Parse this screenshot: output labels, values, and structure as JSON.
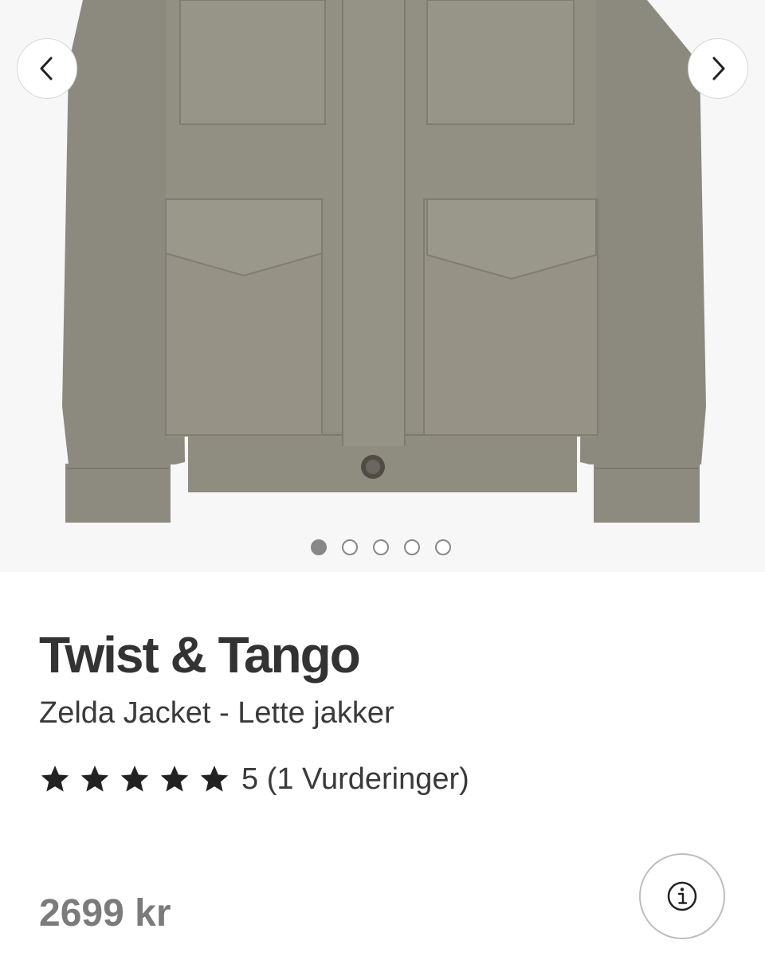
{
  "gallery": {
    "image_alt": "Zelda Jacket",
    "prev_icon": "chevron-left-icon",
    "next_icon": "chevron-right-icon",
    "slide_count": 5,
    "active_slide": 1
  },
  "product": {
    "brand": "Twist & Tango",
    "name": "Zelda Jacket - Lette jakker",
    "rating_value": 5,
    "rating_max": 5,
    "rating_text": "5 (1 Vurderinger)",
    "price": "2699 kr"
  },
  "actions": {
    "info_icon": "info-icon"
  },
  "colors": {
    "jacket": "#8f8d80",
    "background": "#f7f7f7",
    "text": "#333333",
    "price": "#7b7b7b"
  }
}
